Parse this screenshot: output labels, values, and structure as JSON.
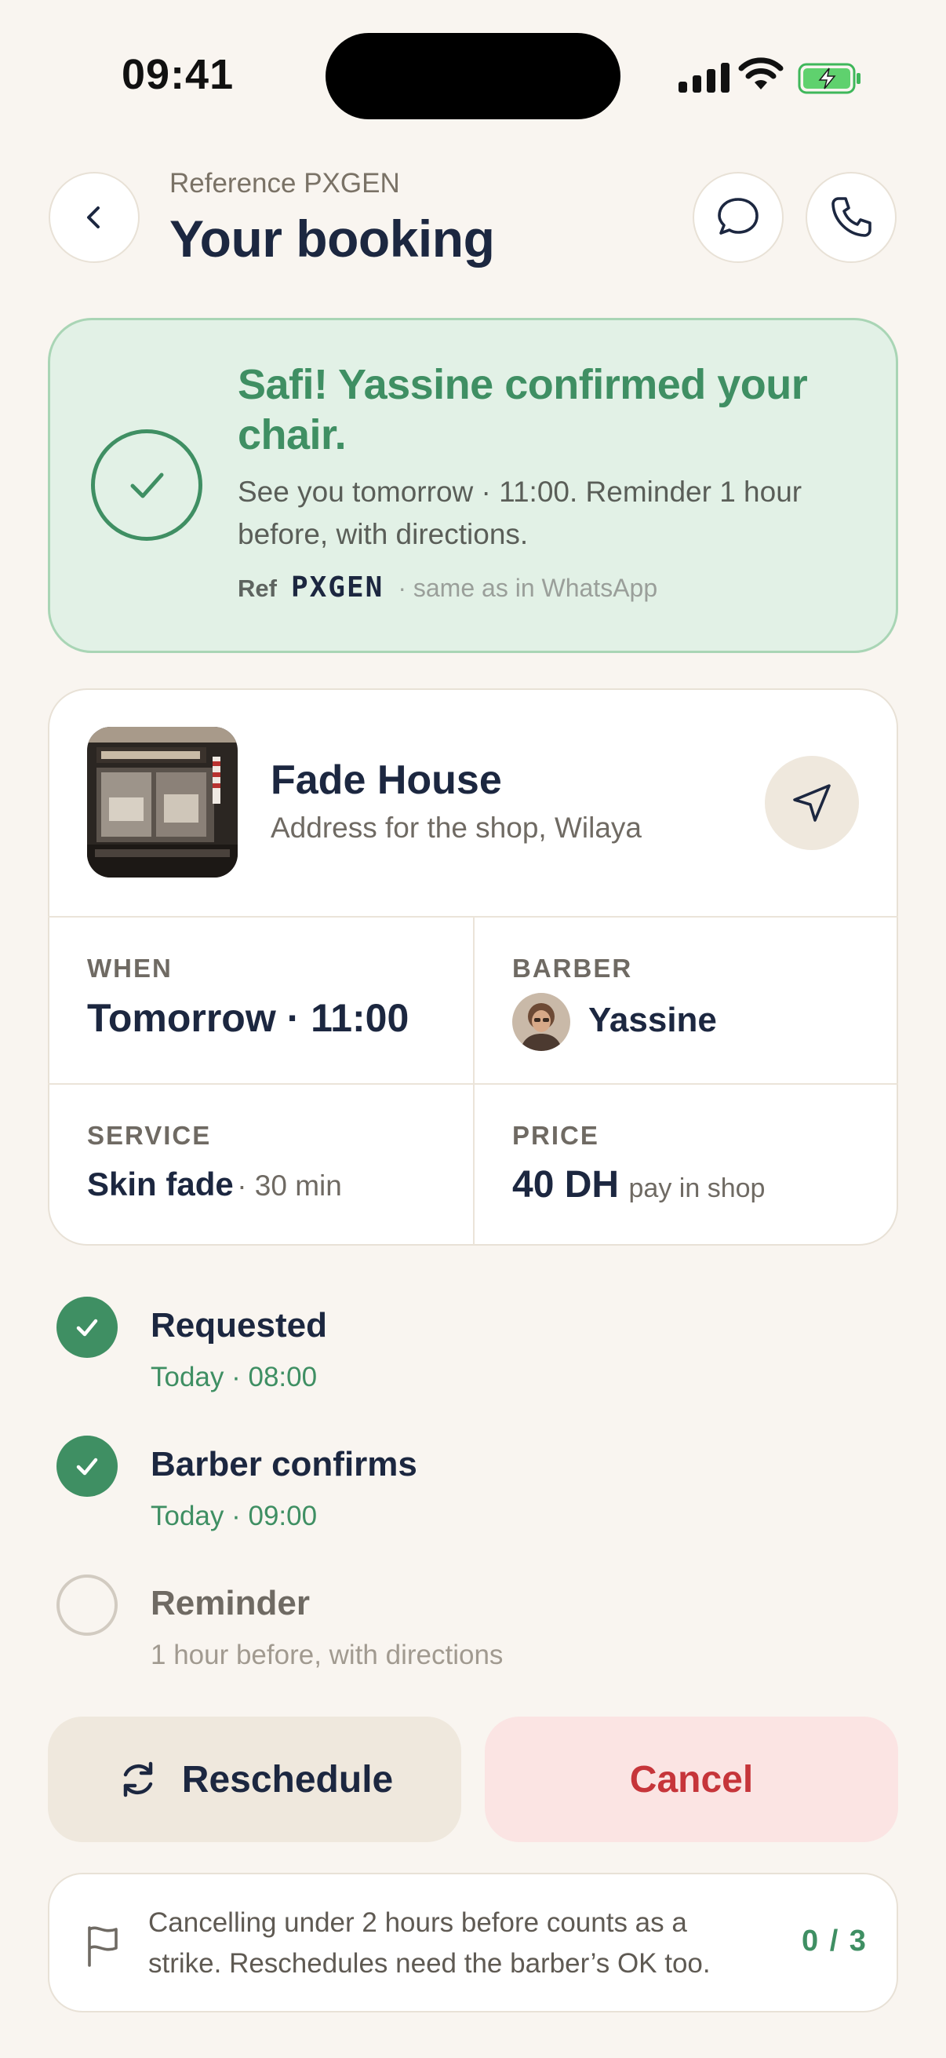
{
  "status_bar": {
    "time": "09:41"
  },
  "header": {
    "reference_label": "Reference PXGEN",
    "title": "Your booking"
  },
  "banner": {
    "title": "Safi! Yassine confirmed your chair.",
    "message": "See you tomorrow · 11:00. Reminder 1 hour before, with directions.",
    "ref_prefix": "Ref",
    "ref_code": "PXGEN",
    "ref_note": "· same as in WhatsApp"
  },
  "shop": {
    "name": "Fade House",
    "address": "Address for the shop, Wilaya"
  },
  "details": {
    "when": {
      "label": "WHEN",
      "value": "Tomorrow · 11:00"
    },
    "barber": {
      "label": "BARBER",
      "value": "Yassine"
    },
    "service": {
      "label": "SERVICE",
      "value": "Skin fade",
      "duration": "· 30 min"
    },
    "price": {
      "label": "PRICE",
      "value": "40 DH",
      "note": "pay in shop"
    }
  },
  "timeline": [
    {
      "title": "Requested",
      "subtitle": "Today · 08:00",
      "status": "done"
    },
    {
      "title": "Barber confirms",
      "subtitle": "Today · 09:00",
      "status": "done"
    },
    {
      "title": "Reminder",
      "subtitle": "1 hour before, with directions",
      "status": "pending"
    }
  ],
  "actions": {
    "reschedule_label": "Reschedule",
    "cancel_label": "Cancel"
  },
  "policy": {
    "text": "Cancelling under 2 hours before counts as a strike. Reschedules need the barber’s OK too.",
    "strike_count": "0 / 3"
  },
  "colors": {
    "background": "#f9f5f0",
    "accent_green": "#3f8f63",
    "banner_bg": "#e2f1e6",
    "text_dark": "#1c2740",
    "cancel_red": "#c6353a",
    "cancel_bg": "#fbe4e3"
  },
  "icons": {
    "back": "chevron-left-icon",
    "chat": "chat-bubble-icon",
    "phone": "phone-icon",
    "navigate": "navigation-arrow-icon",
    "check": "check-icon",
    "reschedule": "refresh-icon",
    "policy": "flag-icon"
  }
}
